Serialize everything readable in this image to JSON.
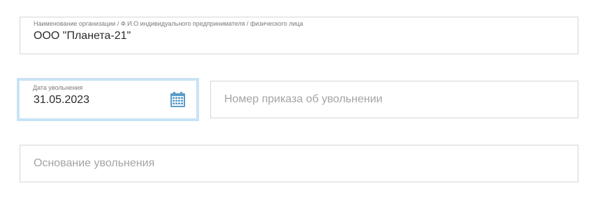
{
  "organization": {
    "label": "Наименование организации / Ф.И.О индивидуального предпринимателя / физического лица",
    "value": "ООО \"Планета-21\""
  },
  "dismissal_date": {
    "label": "Дата увольнения",
    "value": "31.05.2023",
    "icon": "calendar-icon"
  },
  "order_number": {
    "placeholder": "Номер приказа об увольнении"
  },
  "dismissal_reason": {
    "placeholder": "Основание увольнения"
  },
  "colors": {
    "focus_border": "#c8e3f5",
    "field_border": "#d6d6d6",
    "icon": "#5a9cc7"
  }
}
